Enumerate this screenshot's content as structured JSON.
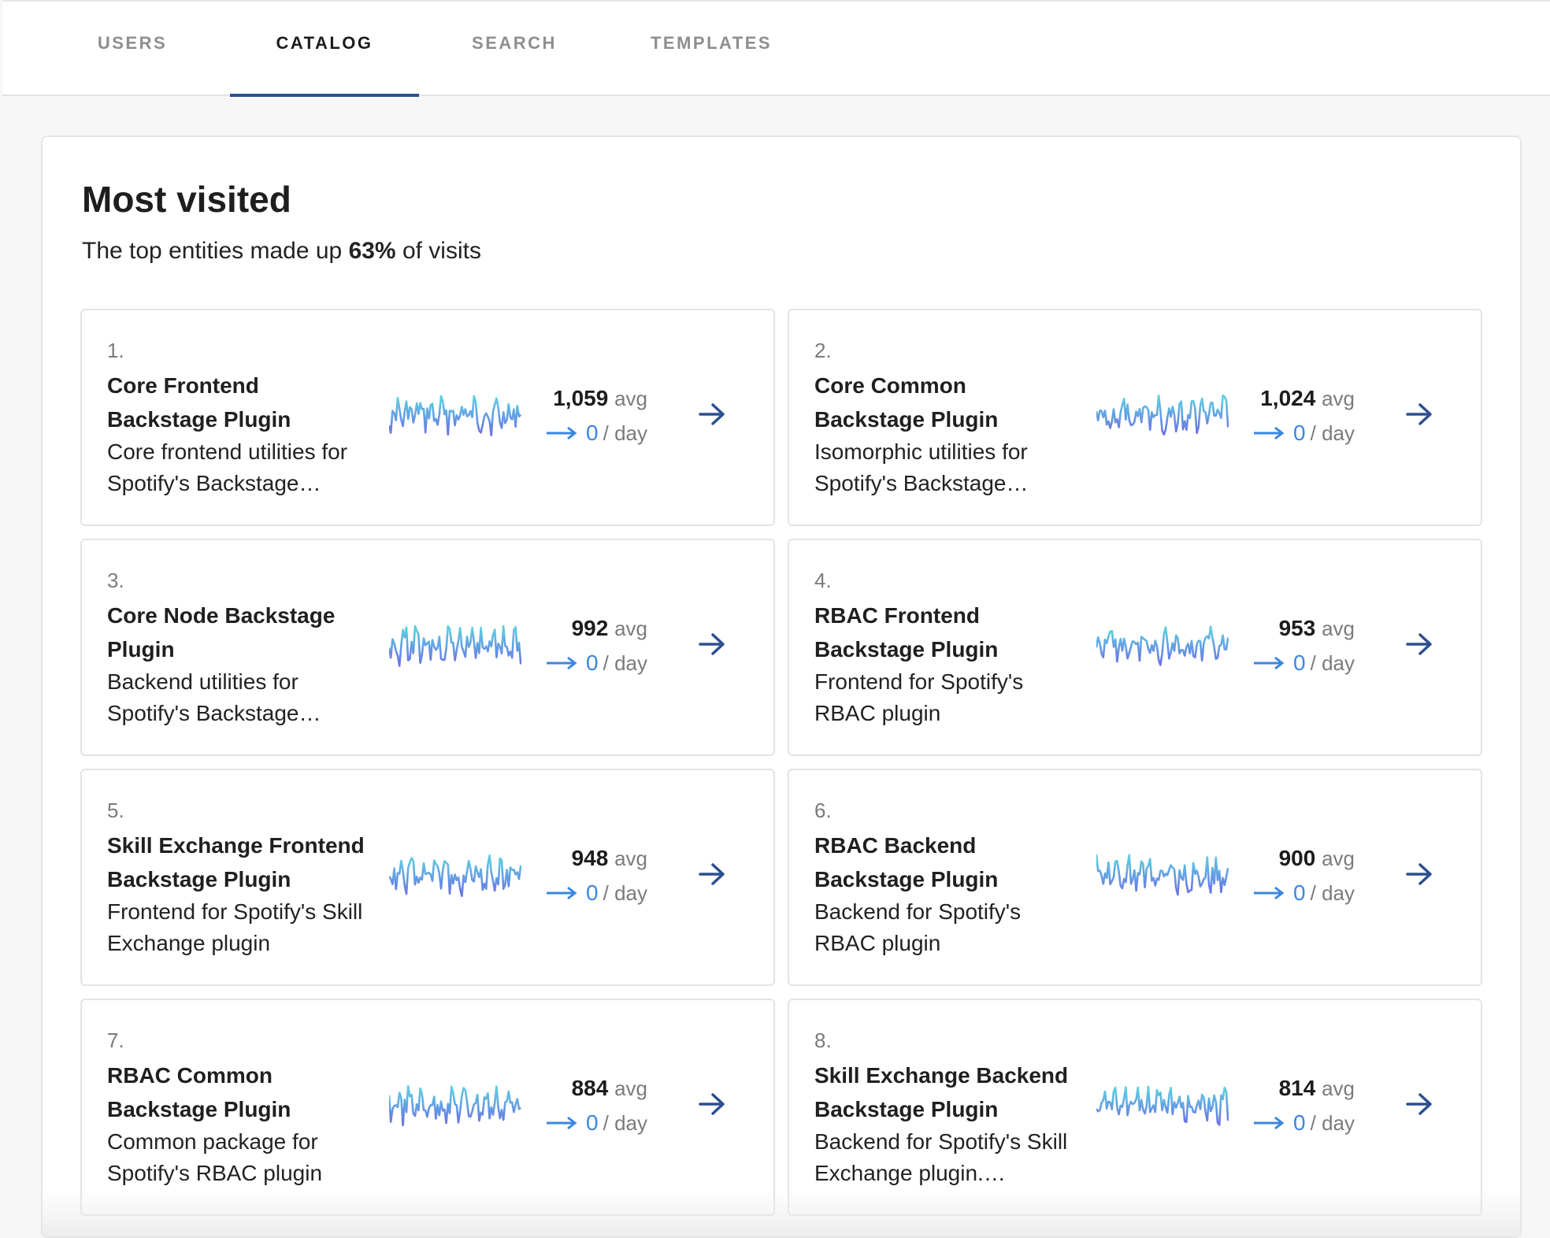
{
  "tabs": [
    {
      "label": "USERS",
      "active": false
    },
    {
      "label": "CATALOG",
      "active": true
    },
    {
      "label": "SEARCH",
      "active": false
    },
    {
      "label": "TEMPLATES",
      "active": false
    }
  ],
  "panel": {
    "title": "Most visited",
    "subtitle_prefix": "The top entities made up",
    "subtitle_percent": "63%",
    "subtitle_suffix": "of visits"
  },
  "colors": {
    "accent": "#2c4f8f",
    "spark_top": "#5bd3e0",
    "spark_bottom": "#6b6fe6",
    "trend": "#3a87e0"
  },
  "entities": [
    {
      "rank": "1.",
      "name": "Core Frontend Backstage Plugin",
      "description": "Core frontend utilities for Spotify's Backstage…",
      "avg": "1,059",
      "avg_label": "avg",
      "per_day": "0",
      "per_day_label": "/ day",
      "action_icon": "arrow-right-icon"
    },
    {
      "rank": "2.",
      "name": "Core Common Backstage Plugin",
      "description": "Isomorphic utilities for Spotify's Backstage…",
      "avg": "1,024",
      "avg_label": "avg",
      "per_day": "0",
      "per_day_label": "/ day",
      "action_icon": "arrow-right-icon"
    },
    {
      "rank": "3.",
      "name": "Core Node Backstage Plugin",
      "description": "Backend utilities for Spotify's Backstage…",
      "avg": "992",
      "avg_label": "avg",
      "per_day": "0",
      "per_day_label": "/ day",
      "action_icon": "arrow-right-icon"
    },
    {
      "rank": "4.",
      "name": "RBAC Frontend Backstage Plugin",
      "description": "Frontend for Spotify's RBAC plugin",
      "avg": "953",
      "avg_label": "avg",
      "per_day": "0",
      "per_day_label": "/ day",
      "action_icon": "arrow-right-icon"
    },
    {
      "rank": "5.",
      "name": "Skill Exchange Frontend Backstage Plugin",
      "description": "Frontend for Spotify's Skill Exchange plugin",
      "avg": "948",
      "avg_label": "avg",
      "per_day": "0",
      "per_day_label": "/ day",
      "action_icon": "arrow-right-icon"
    },
    {
      "rank": "6.",
      "name": "RBAC Backend Backstage Plugin",
      "description": "Backend for Spotify's RBAC plugin",
      "avg": "900",
      "avg_label": "avg",
      "per_day": "0",
      "per_day_label": "/ day",
      "action_icon": "arrow-right-icon"
    },
    {
      "rank": "7.",
      "name": "RBAC Common Backstage Plugin",
      "description": "Common package for Spotify's RBAC plugin",
      "avg": "884",
      "avg_label": "avg",
      "per_day": "0",
      "per_day_label": "/ day",
      "action_icon": "arrow-right-icon"
    },
    {
      "rank": "8.",
      "name": "Skill Exchange Backend Backstage Plugin",
      "description": "Backend for Spotify's Skill Exchange plugin.…",
      "avg": "814",
      "avg_label": "avg",
      "per_day": "0",
      "per_day_label": "/ day",
      "action_icon": "arrow-right-icon"
    }
  ]
}
